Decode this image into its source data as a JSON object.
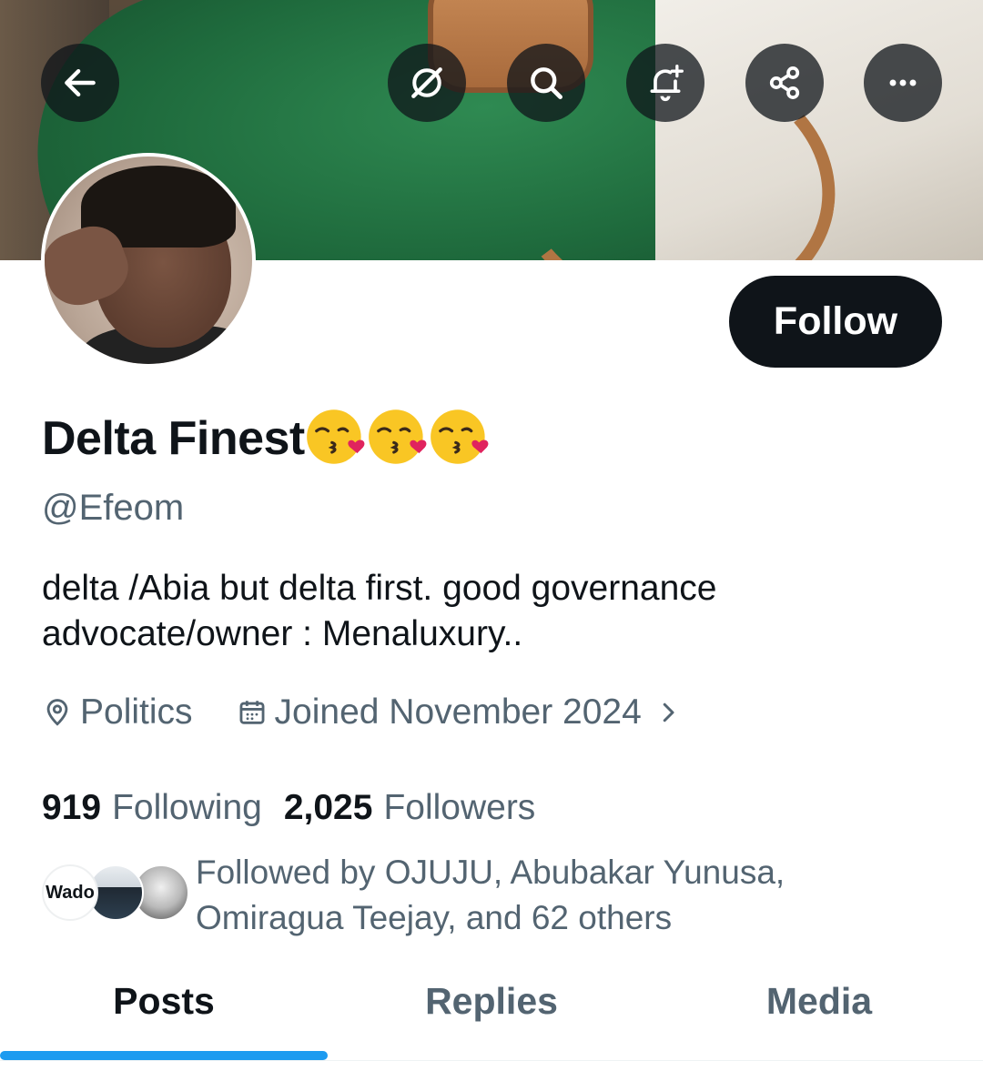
{
  "toolbar": {
    "back_icon": "arrow-left-icon",
    "grok_icon": "grok-icon",
    "search_icon": "search-icon",
    "notify_icon": "bell-plus-icon",
    "share_icon": "share-icon",
    "more_icon": "more-icon"
  },
  "profile": {
    "name": "Delta Finest",
    "name_emojis": [
      "😘",
      "😘",
      "😘"
    ],
    "handle": "@Efeom",
    "bio_lines": [
      "delta /Abia but delta first. good governance",
      "advocate/owner : Menaluxury.."
    ],
    "location": "Politics",
    "joined": "Joined November 2024",
    "follow_label": "Follow"
  },
  "stats": {
    "following_count": "919",
    "following_label": "Following",
    "followers_count": "2,025",
    "followers_label": "Followers"
  },
  "mutuals": {
    "first_avatar_text": "Wado",
    "lines": [
      "Followed by OJUJU, Abubakar Yunusa,",
      "Omiragua Teejay, and 62 others"
    ]
  },
  "tabs": [
    {
      "label": "Posts",
      "active": true
    },
    {
      "label": "Replies",
      "active": false
    },
    {
      "label": "Media",
      "active": false
    }
  ],
  "colors": {
    "accent": "#1d9bf0",
    "text_primary": "#0f1419",
    "text_secondary": "#536471"
  }
}
